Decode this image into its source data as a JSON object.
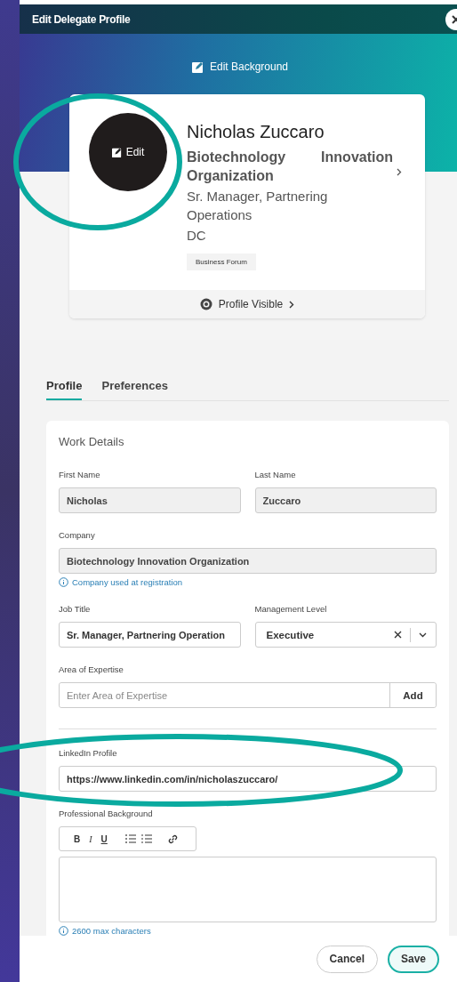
{
  "window": {
    "title": "Edit Delegate Profile"
  },
  "hero": {
    "edit_background": "Edit Background"
  },
  "profile_card": {
    "avatar_edit": "Edit",
    "name": "Nicholas Zuccaro",
    "company": "Biotechnology Innovation Organization",
    "job_title": "Sr. Manager, Partnering Operations",
    "location": "DC",
    "tag": "Business Forum",
    "visibility": "Profile Visible"
  },
  "tabs": [
    {
      "label": "Profile",
      "selected": true
    },
    {
      "label": "Preferences",
      "selected": false
    }
  ],
  "work_details": {
    "title": "Work Details",
    "rows": [
      [
        {
          "kind": "text",
          "label": "First Name",
          "value": "Nicholas",
          "disabled": true
        },
        {
          "kind": "text",
          "label": "Last Name",
          "value": "Zuccaro",
          "disabled": true
        }
      ],
      [
        {
          "kind": "text",
          "label": "Company",
          "value": "Biotechnology Innovation Organization",
          "disabled": true,
          "hint": "Company used at registration"
        }
      ],
      [
        {
          "kind": "text",
          "label": "Job Title",
          "value": "Sr. Manager, Partnering Operation",
          "disabled": false
        },
        {
          "kind": "select",
          "label": "Management Level",
          "value": "Executive"
        }
      ],
      [
        {
          "kind": "add",
          "label": "Area of Expertise",
          "placeholder": "Enter Area of Expertise",
          "button": "Add"
        }
      ],
      [
        {
          "kind": "divider"
        }
      ],
      [
        {
          "kind": "text",
          "label": "LinkedIn Profile",
          "value": "https://www.linkedin.com/in/nicholaszuccaro/",
          "disabled": false
        }
      ],
      [
        {
          "kind": "richtext",
          "label": "Professional Background",
          "hint": "2600 max characters",
          "toolbar": [
            {
              "kind": "bold",
              "label": "B"
            },
            {
              "kind": "italic",
              "label": "I"
            },
            {
              "kind": "underline",
              "label": "U"
            },
            {
              "kind": "ordered_list"
            },
            {
              "kind": "bullet_list"
            },
            {
              "kind": "link"
            }
          ]
        }
      ]
    ]
  },
  "footer": {
    "buttons": [
      {
        "kind": "secondary",
        "label": "Cancel"
      },
      {
        "kind": "primary",
        "label": "Save"
      }
    ]
  }
}
